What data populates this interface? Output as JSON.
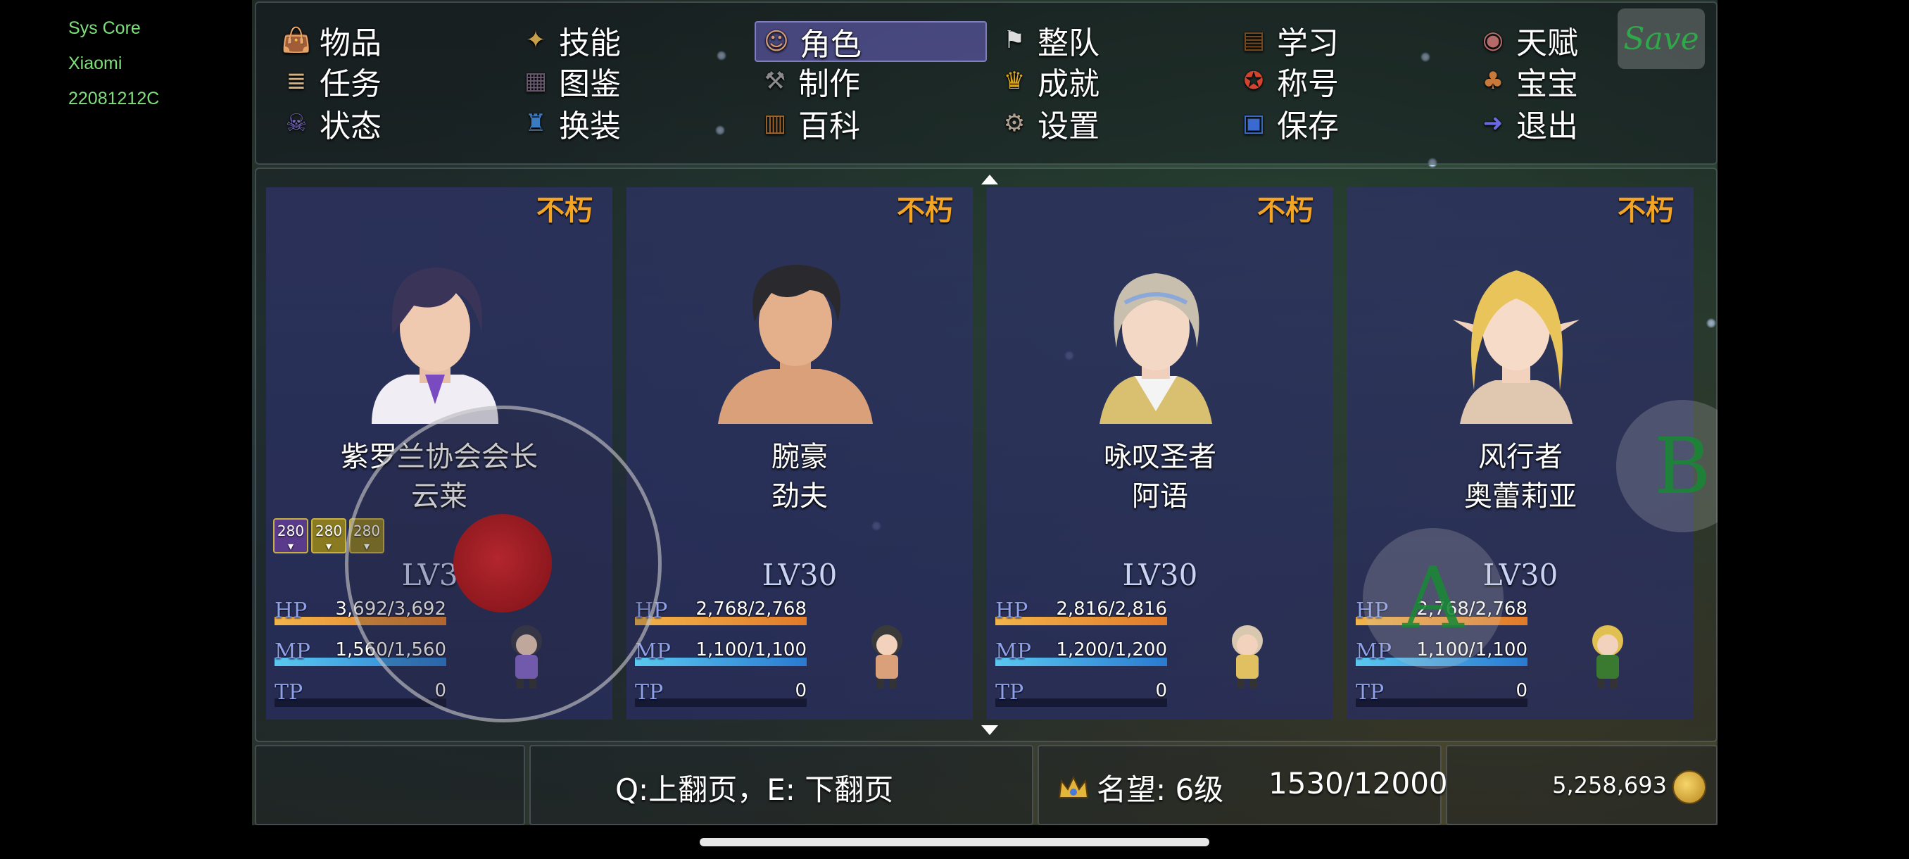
{
  "system": {
    "line1": "Sys Core",
    "line2": "Xiaomi",
    "line3": "22081212C"
  },
  "menu": {
    "items": [
      {
        "label": "物品",
        "icon": "bag-icon"
      },
      {
        "label": "技能",
        "icon": "skill-icon"
      },
      {
        "label": "角色",
        "icon": "mask-icon"
      },
      {
        "label": "整队",
        "icon": "flag-icon"
      },
      {
        "label": "学习",
        "icon": "book-icon"
      },
      {
        "label": "天赋",
        "icon": "talent-icon"
      },
      {
        "label": "任务",
        "icon": "scroll-icon"
      },
      {
        "label": "图鉴",
        "icon": "codex-icon"
      },
      {
        "label": "制作",
        "icon": "anvil-icon"
      },
      {
        "label": "成就",
        "icon": "trophy-icon"
      },
      {
        "label": "称号",
        "icon": "medal-icon"
      },
      {
        "label": "宝宝",
        "icon": "chicken-icon"
      },
      {
        "label": "状态",
        "icon": "skull-icon"
      },
      {
        "label": "换装",
        "icon": "outfit-icon"
      },
      {
        "label": "百科",
        "icon": "encyclopedia-icon"
      },
      {
        "label": "设置",
        "icon": "gear-icon"
      },
      {
        "label": "保存",
        "icon": "floppy-icon"
      },
      {
        "label": "退出",
        "icon": "exit-icon"
      }
    ],
    "selected": "角色",
    "save_label": "Save"
  },
  "party": [
    {
      "status": "不朽",
      "title": "紫罗兰协会会长",
      "name": "云莱",
      "level": "LV38",
      "hp": "3,692/3,692",
      "mp": "1,560/1,560",
      "tp": "0",
      "hp_ratio": 1.0,
      "mp_ratio": 1.0,
      "tp_ratio": 0.0,
      "badges": [
        "280",
        "280",
        "280"
      ]
    },
    {
      "status": "不朽",
      "title": "腕豪",
      "name": "劲夫",
      "level": "LV30",
      "hp": "2,768/2,768",
      "mp": "1,100/1,100",
      "tp": "0",
      "hp_ratio": 1.0,
      "mp_ratio": 1.0,
      "tp_ratio": 0.0,
      "badges": []
    },
    {
      "status": "不朽",
      "title": "咏叹圣者",
      "name": "阿语",
      "level": "LV30",
      "hp": "2,816/2,816",
      "mp": "1,200/1,200",
      "tp": "0",
      "hp_ratio": 1.0,
      "mp_ratio": 1.0,
      "tp_ratio": 0.0,
      "badges": []
    },
    {
      "status": "不朽",
      "title": "风行者",
      "name": "奥蕾莉亚",
      "level": "LV30",
      "hp": "2,768/2,768",
      "mp": "1,100/1,100",
      "tp": "0",
      "hp_ratio": 1.0,
      "mp_ratio": 1.0,
      "tp_ratio": 0.0,
      "badges": []
    }
  ],
  "stat_labels": {
    "hp": "HP",
    "mp": "MP",
    "tp": "TP"
  },
  "footer": {
    "page_hint": "Q:上翻页，E: 下翻页",
    "reputation": "名望: 6级",
    "reputation_progress": "1530/12000",
    "gold": "5,258,693"
  },
  "controls": {
    "a_label": "A",
    "b_label": "B"
  },
  "colors": {
    "accent": "#f3a423",
    "hp": "#e8a23a",
    "mp": "#3ca0e0",
    "card": "#2d3264",
    "selected": "#6e64c8"
  }
}
